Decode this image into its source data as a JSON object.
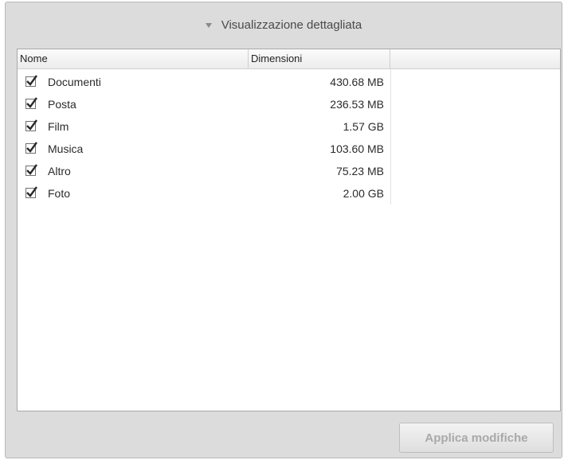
{
  "header": {
    "toggle_label": "Visualizzazione dettagliata",
    "toggle_icon": "triangle-down-icon"
  },
  "table": {
    "columns": [
      "Nome",
      "Dimensioni",
      ""
    ],
    "rows": [
      {
        "name": "Documenti",
        "size": "430.68 MB",
        "checked": true
      },
      {
        "name": "Posta",
        "size": "236.53 MB",
        "checked": true
      },
      {
        "name": "Film",
        "size": "1.57 GB",
        "checked": true
      },
      {
        "name": "Musica",
        "size": "103.60 MB",
        "checked": true
      },
      {
        "name": "Altro",
        "size": "75.23 MB",
        "checked": true
      },
      {
        "name": "Foto",
        "size": "2.00 GB",
        "checked": true
      }
    ]
  },
  "footer": {
    "apply_label": "Applica modifiche"
  },
  "colors": {
    "panel_bg": "#dcdcdc",
    "disabled_text": "#a9a9a9"
  }
}
